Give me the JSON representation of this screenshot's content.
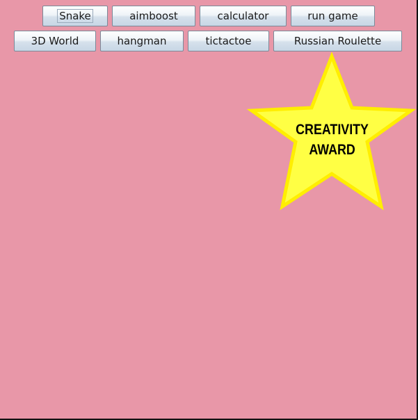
{
  "buttons": {
    "snake": "Snake",
    "aimboost": "aimboost",
    "calculator": "calculator",
    "run_game": "run game",
    "world_3d": "3D World",
    "hangman": "hangman",
    "tictactoe": "tictactoe",
    "russian_roulette": "Russian Roulette"
  },
  "award": {
    "line1": "CREATIVITY",
    "line2": "AWARD",
    "icon": "star-icon"
  },
  "colors": {
    "background": "#e897a8",
    "star_fill": "#ffff44",
    "star_outline": "#ffee00"
  }
}
